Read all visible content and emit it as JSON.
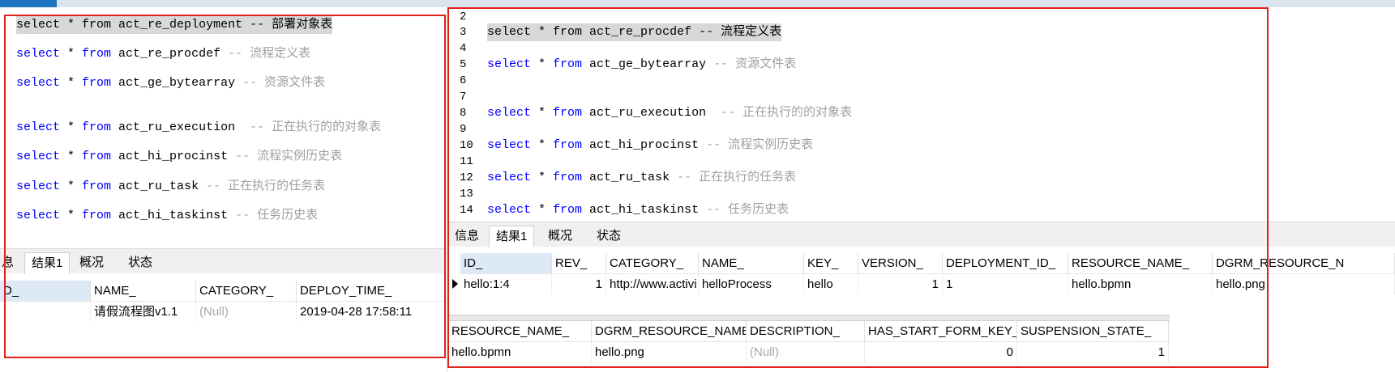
{
  "left": {
    "lines": [
      {
        "kw": "select",
        "mid": " * ",
        "kw2": "from",
        "table": " act_re_deployment ",
        "comment": "-- 部署对象表",
        "highlight": true
      },
      {
        "kw": "select",
        "mid": " * ",
        "kw2": "from",
        "table": " act_re_procdef ",
        "comment": "-- 流程定义表"
      },
      {
        "kw": "select",
        "mid": " * ",
        "kw2": "from",
        "table": " act_ge_bytearray ",
        "comment": "-- 资源文件表"
      },
      {
        "kw": "select",
        "mid": " * ",
        "kw2": "from",
        "table": " act_ru_execution  ",
        "comment": "-- 正在执行的的对象表"
      },
      {
        "kw": "select",
        "mid": " * ",
        "kw2": "from",
        "table": " act_hi_procinst ",
        "comment": "-- 流程实例历史表"
      },
      {
        "kw": "select",
        "mid": " * ",
        "kw2": "from",
        "table": " act_ru_task ",
        "comment": "-- 正在执行的任务表"
      },
      {
        "kw": "select",
        "mid": " * ",
        "kw2": "from",
        "table": " act_hi_taskinst ",
        "comment": "-- 任务历史表"
      }
    ],
    "tabs": [
      "息",
      "结果1",
      "概况",
      "状态"
    ],
    "grid": {
      "headers": [
        "D_",
        "NAME_",
        "CATEGORY_",
        "DEPLOY_TIME_"
      ],
      "row": [
        "",
        "请假流程图v1.1",
        "(Null)",
        "2019-04-28 17:58:11"
      ]
    }
  },
  "right": {
    "line_numbers": [
      "2",
      "3",
      "4",
      "5",
      "6",
      "7",
      "8",
      "9",
      "10",
      "11",
      "12",
      "13",
      "14"
    ],
    "lines": [
      {
        "kw": "select",
        "mid": " * ",
        "kw2": "from",
        "table": " act_re_procdef ",
        "comment": "-- 流程定义表",
        "highlight": true
      },
      {
        "kw": "select",
        "mid": " * ",
        "kw2": "from",
        "table": " act_ge_bytearray ",
        "comment": "-- 资源文件表"
      },
      {
        "kw": "select",
        "mid": " * ",
        "kw2": "from",
        "table": " act_ru_execution  ",
        "comment": "-- 正在执行的的对象表"
      },
      {
        "kw": "select",
        "mid": " * ",
        "kw2": "from",
        "table": " act_hi_procinst ",
        "comment": "-- 流程实例历史表"
      },
      {
        "kw": "select",
        "mid": " * ",
        "kw2": "from",
        "table": " act_ru_task ",
        "comment": "-- 正在执行的任务表"
      },
      {
        "kw": "select",
        "mid": " * ",
        "kw2": "from",
        "table": " act_hi_taskinst ",
        "comment": "-- 任务历史表"
      }
    ],
    "tabs": [
      "信息",
      "结果1",
      "概况",
      "状态"
    ],
    "grid1": {
      "headers": [
        "ID_",
        "REV_",
        "CATEGORY_",
        "NAME_",
        "KEY_",
        "VERSION_",
        "DEPLOYMENT_ID_",
        "RESOURCE_NAME_",
        "DGRM_RESOURCE_N"
      ],
      "row": [
        "hello:1:4",
        "1",
        "http://www.activi",
        "helloProcess",
        "hello",
        "1",
        "1",
        "hello.bpmn",
        "hello.png"
      ]
    },
    "grid2": {
      "headers": [
        "RESOURCE_NAME_",
        "DGRM_RESOURCE_NAME",
        "DESCRIPTION_",
        "HAS_START_FORM_KEY_",
        "SUSPENSION_STATE_"
      ],
      "row": [
        "hello.bpmn",
        "hello.png",
        "(Null)",
        "0",
        "1"
      ]
    }
  },
  "colors": {
    "keyword": "#0000ff",
    "comment": "#a0a0a0",
    "outline": "#e0201c",
    "accent": "#1e73be"
  }
}
